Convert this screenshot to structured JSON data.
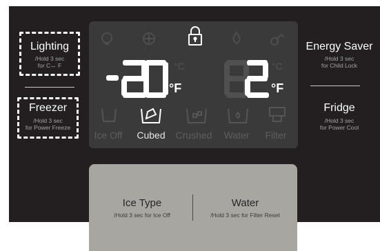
{
  "left": {
    "lighting": {
      "title": "Lighting",
      "sub1": "/Hold 3 sec",
      "sub2": "for  C↔ F"
    },
    "freezer": {
      "title": "Freezer",
      "sub1": "/Hold 3 sec",
      "sub2": "for Power Freeze"
    }
  },
  "right": {
    "energy_saver": {
      "title": "Energy Saver",
      "sub1": "/Hold 3 sec",
      "sub2": "for Child Lock"
    },
    "fridge": {
      "title": "Fridge",
      "sub1": "/Hold 3 sec",
      "sub2": "for Power Cool"
    }
  },
  "display": {
    "freezer_temp": "-20",
    "freezer_unit": "°F",
    "fridge_temp": "2",
    "fridge_unit": "°F",
    "modes": [
      "Ice Off",
      "Cubed",
      "Crushed",
      "Water",
      "Filter"
    ],
    "active_mode": "Cubed"
  },
  "bottom": {
    "ice_type": {
      "title": "Ice Type",
      "sub": "/Hold 3 sec for Ice Off"
    },
    "water": {
      "title": "Water",
      "sub": "/Hold 3 sec for Filter Reset"
    }
  },
  "colors": {
    "panel": "#231f20",
    "display": "#3a3a3a",
    "lit_segment": "#ffffff",
    "ghost_segment": "#505050",
    "bottom_panel": "#a7a6a1"
  }
}
